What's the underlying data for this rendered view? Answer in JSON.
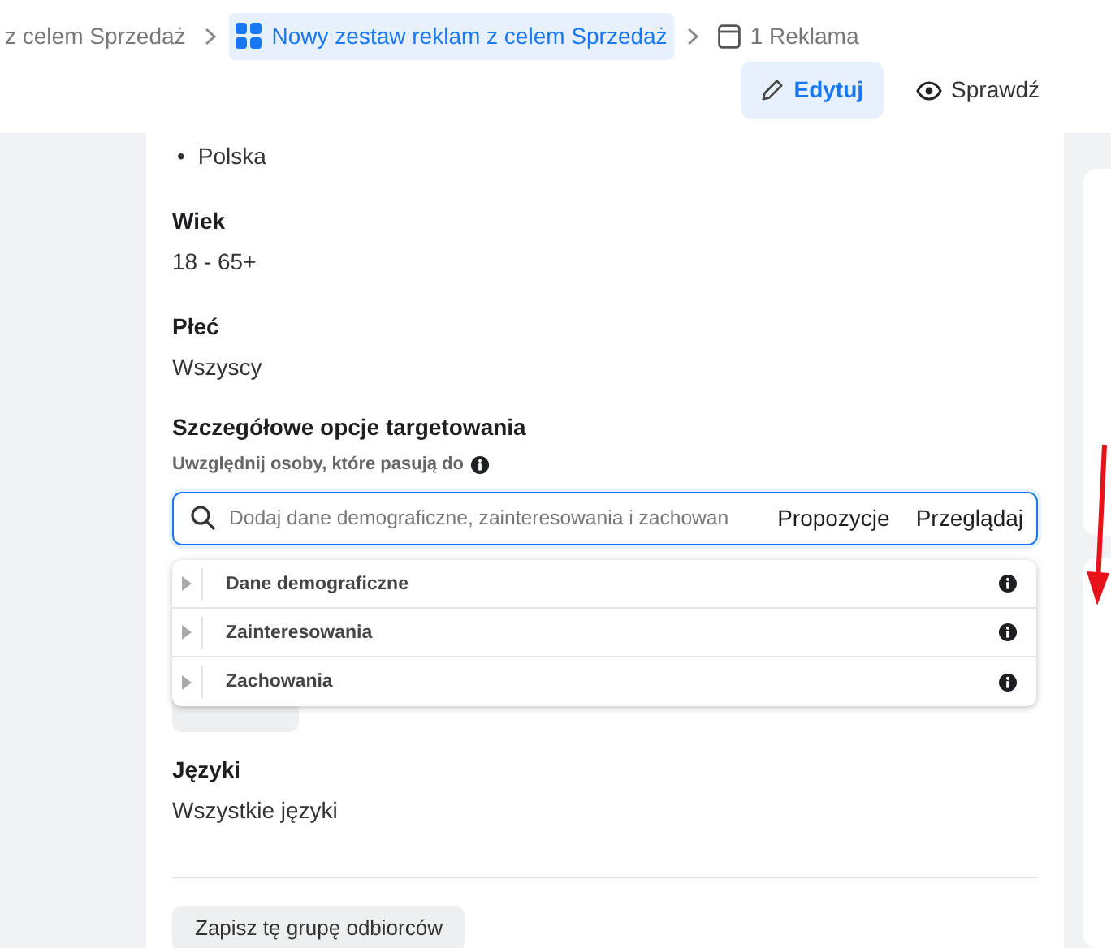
{
  "breadcrumb": [
    {
      "label": "z celem Sprzedaż",
      "selected": false,
      "kind": "campaign"
    },
    {
      "label": "Nowy zestaw reklam z celem Sprzedaż",
      "selected": true,
      "kind": "adset"
    },
    {
      "label": "1 Reklama",
      "selected": false,
      "kind": "ad"
    }
  ],
  "mode_buttons": [
    {
      "label": "Edytuj",
      "selected": true,
      "kind": "edit"
    },
    {
      "label": "Sprawdź",
      "selected": false,
      "kind": "review"
    }
  ],
  "audience": {
    "locations": [
      {
        "marker": "•",
        "label": "Polska"
      }
    ],
    "sections": [
      {
        "heading": "Wiek",
        "value": "18 - 65+"
      },
      {
        "heading": "Płeć",
        "value": "Wszyscy"
      }
    ],
    "detailed_targeting": {
      "heading": "Szczegółowe opcje targetowania",
      "subheading": "Uwzględnij osoby, które pasują do",
      "search": {
        "placeholder": "Dodaj dane demograficzne, zainteresowania i zachowan",
        "actions": [
          "Propozycje",
          "Przeglądaj"
        ]
      },
      "categories": [
        {
          "label": "Dane demograficzne",
          "expanded": false
        },
        {
          "label": "Zainteresowania",
          "expanded": false
        },
        {
          "label": "Zachowania",
          "expanded": false
        }
      ]
    },
    "languages": {
      "heading": "Języki",
      "value": "Wszystkie języki"
    },
    "save_button": "Zapisz tę grupę odbiorców"
  }
}
